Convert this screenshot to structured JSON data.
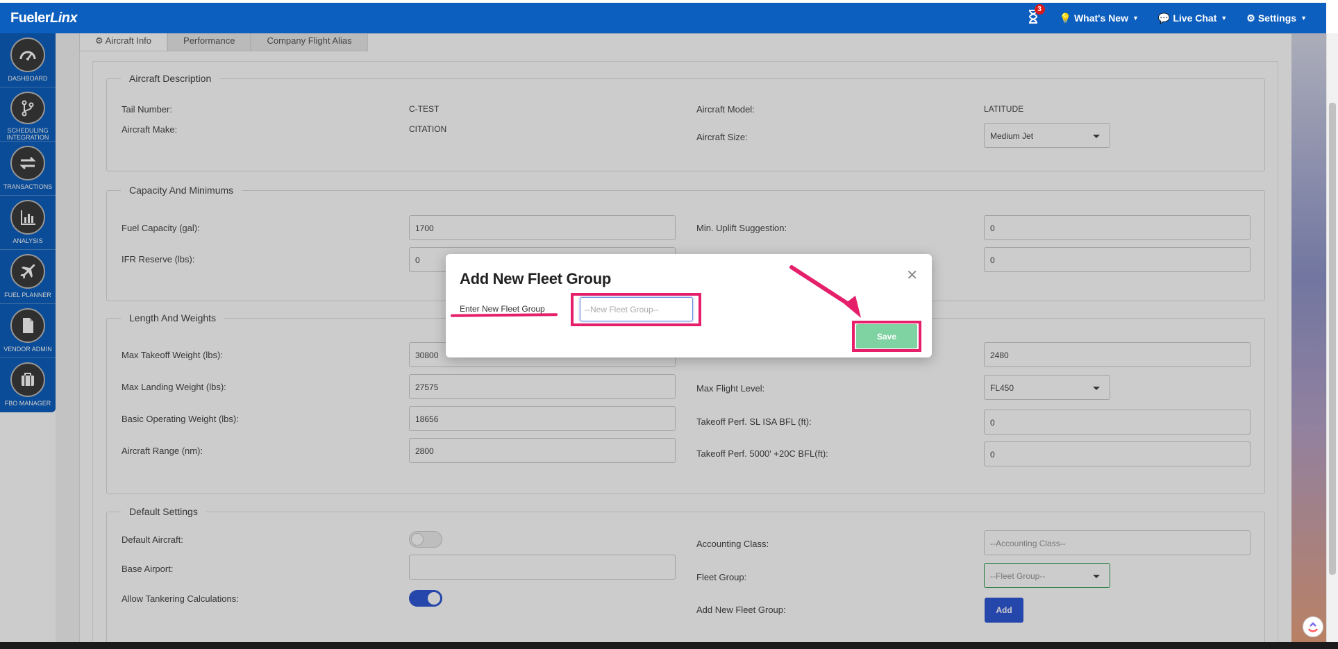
{
  "app": {
    "logo_main": "Fueler",
    "logo_accent": "Linx"
  },
  "topnav": {
    "notification_count": "3",
    "whats_new": "What's New",
    "live_chat": "Live Chat",
    "settings": "Settings"
  },
  "sidebar": {
    "items": [
      {
        "label": "DASHBOARD",
        "icon": "speedometer-icon"
      },
      {
        "label": "SCHEDULING INTEGRATION",
        "icon": "branch-icon"
      },
      {
        "label": "TRANSACTIONS",
        "icon": "swap-arrows-icon"
      },
      {
        "label": "ANALYSIS",
        "icon": "bar-chart-icon"
      },
      {
        "label": "FUEL PLANNER",
        "icon": "airplane-icon"
      },
      {
        "label": "VENDOR ADMIN",
        "icon": "document-icon"
      },
      {
        "label": "FBO MANAGER",
        "icon": "briefcase-icon"
      }
    ]
  },
  "tabs": [
    {
      "label": "Aircraft Info"
    },
    {
      "label": "Performance"
    },
    {
      "label": "Company Flight Alias"
    }
  ],
  "aircraft_description": {
    "legend": "Aircraft Description",
    "tail_number_label": "Tail Number:",
    "tail_number_value": "C-TEST",
    "aircraft_make_label": "Aircraft Make:",
    "aircraft_make_value": "CITATION",
    "aircraft_model_label": "Aircraft Model:",
    "aircraft_model_value": "LATITUDE",
    "aircraft_size_label": "Aircraft Size:",
    "aircraft_size_value": "Medium Jet"
  },
  "capacity": {
    "legend": "Capacity And Minimums",
    "fuel_capacity_label": "Fuel Capacity (gal):",
    "fuel_capacity_value": "1700",
    "ifr_reserve_label": "IFR Reserve (lbs):",
    "ifr_reserve_value": "0",
    "min_uplift_label": "Min. Uplift Suggestion:",
    "min_uplift_value": "0",
    "right_second_value": "0"
  },
  "weights": {
    "legend": "Length And Weights",
    "max_takeoff_label": "Max Takeoff Weight (lbs):",
    "max_takeoff_value": "30800",
    "max_landing_label": "Max Landing Weight (lbs):",
    "max_landing_value": "27575",
    "basic_operating_label": "Basic Operating Weight (lbs):",
    "basic_operating_value": "18656",
    "aircraft_range_label": "Aircraft Range (nm):",
    "aircraft_range_value": "2800",
    "right_first_value": "2480",
    "max_flight_level_label": "Max Flight Level:",
    "max_flight_level_value": "FL450",
    "takeoff_sl_label": "Takeoff Perf. SL ISA BFL (ft):",
    "takeoff_sl_value": "0",
    "takeoff_5000_label": "Takeoff Perf. 5000' +20C BFL(ft):",
    "takeoff_5000_value": "0"
  },
  "defaults": {
    "legend": "Default Settings",
    "default_aircraft_label": "Default Aircraft:",
    "base_airport_label": "Base Airport:",
    "allow_tankering_label": "Allow Tankering Calculations:",
    "accounting_class_label": "Accounting Class:",
    "accounting_class_placeholder": "--Accounting Class--",
    "fleet_group_label": "Fleet Group:",
    "fleet_group_placeholder": "--Fleet Group--",
    "add_fleet_group_label": "Add New Fleet Group:",
    "add_button": "Add"
  },
  "modal": {
    "title": "Add New Fleet Group",
    "field_label": "Enter New Fleet Group",
    "input_placeholder": "--New Fleet Group--",
    "save_button": "Save",
    "close_icon": "close-icon"
  },
  "colors": {
    "brand_blue": "#0d5fbf",
    "highlight_pink": "#e51f6a",
    "save_green": "#7fd2a1",
    "accent_blue": "#2f59d6"
  }
}
